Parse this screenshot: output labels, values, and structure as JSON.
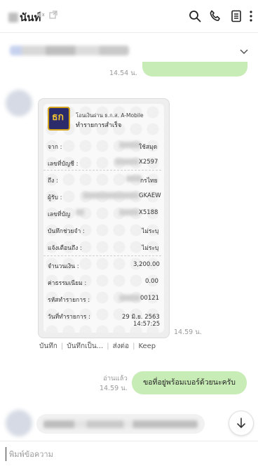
{
  "header": {
    "title": "นันท์",
    "icons": [
      "search-icon",
      "phone-icon",
      "notes-icon",
      "more-icon"
    ]
  },
  "chat": {
    "times": {
      "first": "14.54 น.",
      "receipt": "14.59 น.",
      "outgoing": "14.59 น."
    },
    "receipt": {
      "org": "โอนเงินผ่าน ธ.ก.ส. A-Mobile",
      "status": "ทำรายการสำเร็จ",
      "logo_text": "ธก",
      "rows": [
        {
          "label": "จาก :",
          "value": "ใช้สมุด"
        },
        {
          "label": "เลขที่บัญชี :",
          "value": "X2597"
        },
        {
          "label": "ถึง :",
          "value": "กรไทย"
        },
        {
          "label": "ผู้รับ :",
          "value": "GKAEW"
        },
        {
          "label": "เลขที่บัญ",
          "value": "X5188"
        },
        {
          "label": "บันทึกช่วยจำ :",
          "value": "ไม่ระบุ"
        },
        {
          "label": "แจ้งเตือนถึง :",
          "value": "ไม่ระบุ"
        },
        {
          "label": "จำนวนเงิน :",
          "value": "3,200.00"
        },
        {
          "label": "ค่าธรรมเนียม :",
          "value": "0.00"
        },
        {
          "label": "รหัสทำรายการ :",
          "value": "00121"
        },
        {
          "label": "วันที่ทำรายการ :",
          "value": "29 มิ.ย. 2563"
        },
        {
          "label": "",
          "value": "14:57:25"
        }
      ]
    },
    "actions": [
      "บันทึก",
      "บันทึกเป็น...",
      "ส่งต่อ",
      "Keep"
    ],
    "read_label": "อ่านแล้ว",
    "outgoing_message": "ขอที่อยู่พร้อมเบอร์ด้วยนะครับ"
  },
  "input": {
    "placeholder": "พิมพ์ข้อความ"
  }
}
